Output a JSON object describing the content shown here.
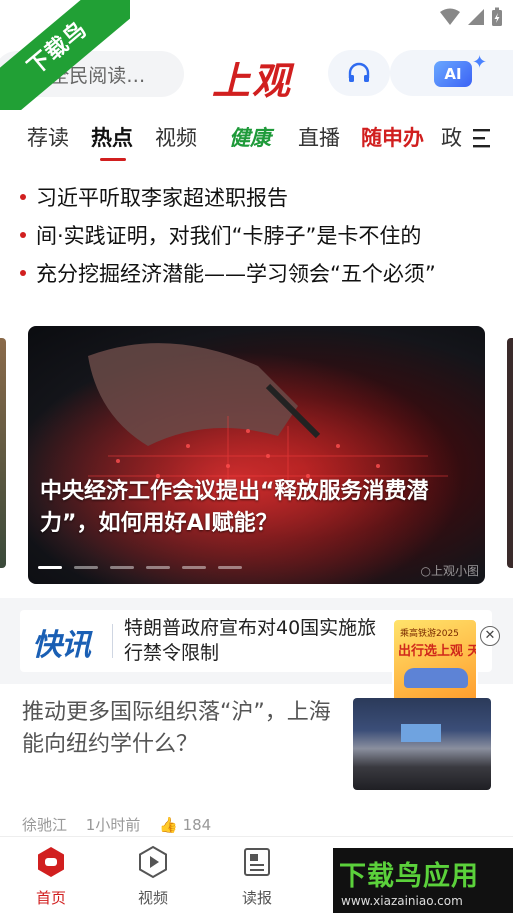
{
  "watermark": {
    "ribbon_text": "下载鸟",
    "banner_text": "下载鸟应用",
    "banner_url": "www.xiazainiao.com"
  },
  "header": {
    "search_placeholder": "《全民阅读…",
    "logo_text": "上观",
    "ai_label": "AI"
  },
  "tabs": [
    {
      "label": "荐读",
      "active": false
    },
    {
      "label": "热点",
      "active": true
    },
    {
      "label": "视频",
      "active": false
    },
    {
      "label": "健康",
      "active": false,
      "color": "#1f9a3a"
    },
    {
      "label": "直播",
      "active": false
    },
    {
      "label": "随申办",
      "active": false,
      "color": "#d11f1f"
    },
    {
      "label": "政",
      "active": false
    }
  ],
  "headlines": [
    "习近平听取李家超述职报告",
    "间·实践证明，对我们“卡脖子”是卡不住的",
    "充分挖掘经济潜能——学习领会“五个必须”"
  ],
  "carousel": {
    "title": "中央经济工作会议提出“释放服务消费潜力”，如何用好AI赋能？",
    "slide_count": 6,
    "active_index": 0,
    "watermark": "○上观小图"
  },
  "flash": {
    "logo": "快讯",
    "text": "特朗普政府宣布对40国实施旅行禁令限制"
  },
  "ad": {
    "tag": "乘高铁游2025",
    "title": "出行选上观 天天抽免单"
  },
  "news": {
    "title": "推动更多国际组织落“沪”，上海能向纽约学什么？",
    "author": "徐驰江",
    "time": "1小时前",
    "likes": "184"
  },
  "bottom_nav": [
    {
      "label": "首页",
      "icon": "home-icon",
      "active": true
    },
    {
      "label": "视频",
      "icon": "video-icon",
      "active": false
    },
    {
      "label": "读报",
      "icon": "newspaper-icon",
      "active": false
    }
  ],
  "colors": {
    "brand": "#d11f1f",
    "health": "#1f9a3a",
    "flash": "#1a5fb4"
  }
}
